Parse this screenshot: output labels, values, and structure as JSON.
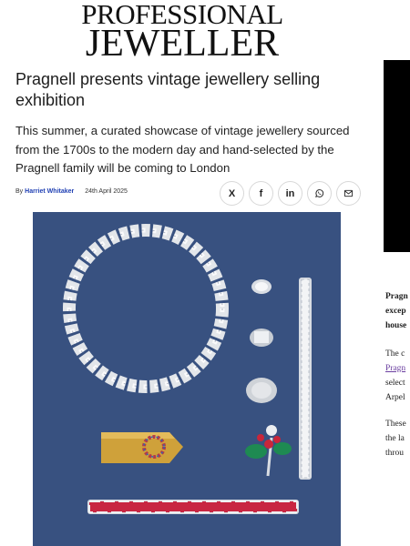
{
  "masthead": {
    "line1": "PROFESSIONAL",
    "line2": "JEWELLER"
  },
  "article": {
    "headline": "Pragnell presents vintage jewellery selling exhibition",
    "standfirst": "This summer, a curated showcase of vintage jewellery sourced from the 1700s to the modern day and hand-selected by the Pragnell family will be coming to London",
    "byline": {
      "by": "By",
      "author": "Harriet Whitaker",
      "date": "24th April 2025"
    }
  },
  "share": [
    {
      "icon": "x-icon",
      "label": "X"
    },
    {
      "icon": "facebook-icon",
      "label": "f"
    },
    {
      "icon": "linkedin-icon",
      "label": "in"
    },
    {
      "icon": "whatsapp-icon",
      "label": ""
    },
    {
      "icon": "email-icon",
      "label": ""
    }
  ],
  "sidebar": {
    "p1": [
      "Pragn",
      "excep",
      "house"
    ],
    "p2": [
      "The c",
      "Pragn",
      "select",
      "Arpel"
    ],
    "p3": [
      "These",
      "the la",
      "throu"
    ]
  },
  "colors": {
    "hero_bg": "#3b5583",
    "author_link": "#1f3fb3",
    "ad_panel": "#000000"
  }
}
